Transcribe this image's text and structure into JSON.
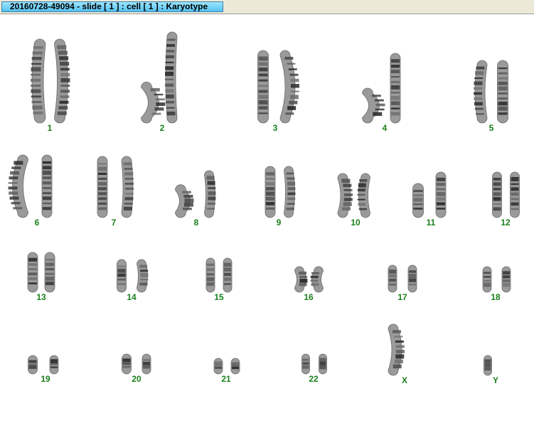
{
  "window": {
    "title": "20160728-49094 - slide [ 1 ] : cell [ 1 ] : Karyotype"
  },
  "karyotype": {
    "label_color": "#1a7f1a",
    "labels": [
      "1",
      "2",
      "3",
      "4",
      "5",
      "6",
      "7",
      "8",
      "9",
      "10",
      "11",
      "12",
      "13",
      "14",
      "15",
      "16",
      "17",
      "18",
      "19",
      "20",
      "21",
      "22",
      "X",
      "Y"
    ]
  }
}
